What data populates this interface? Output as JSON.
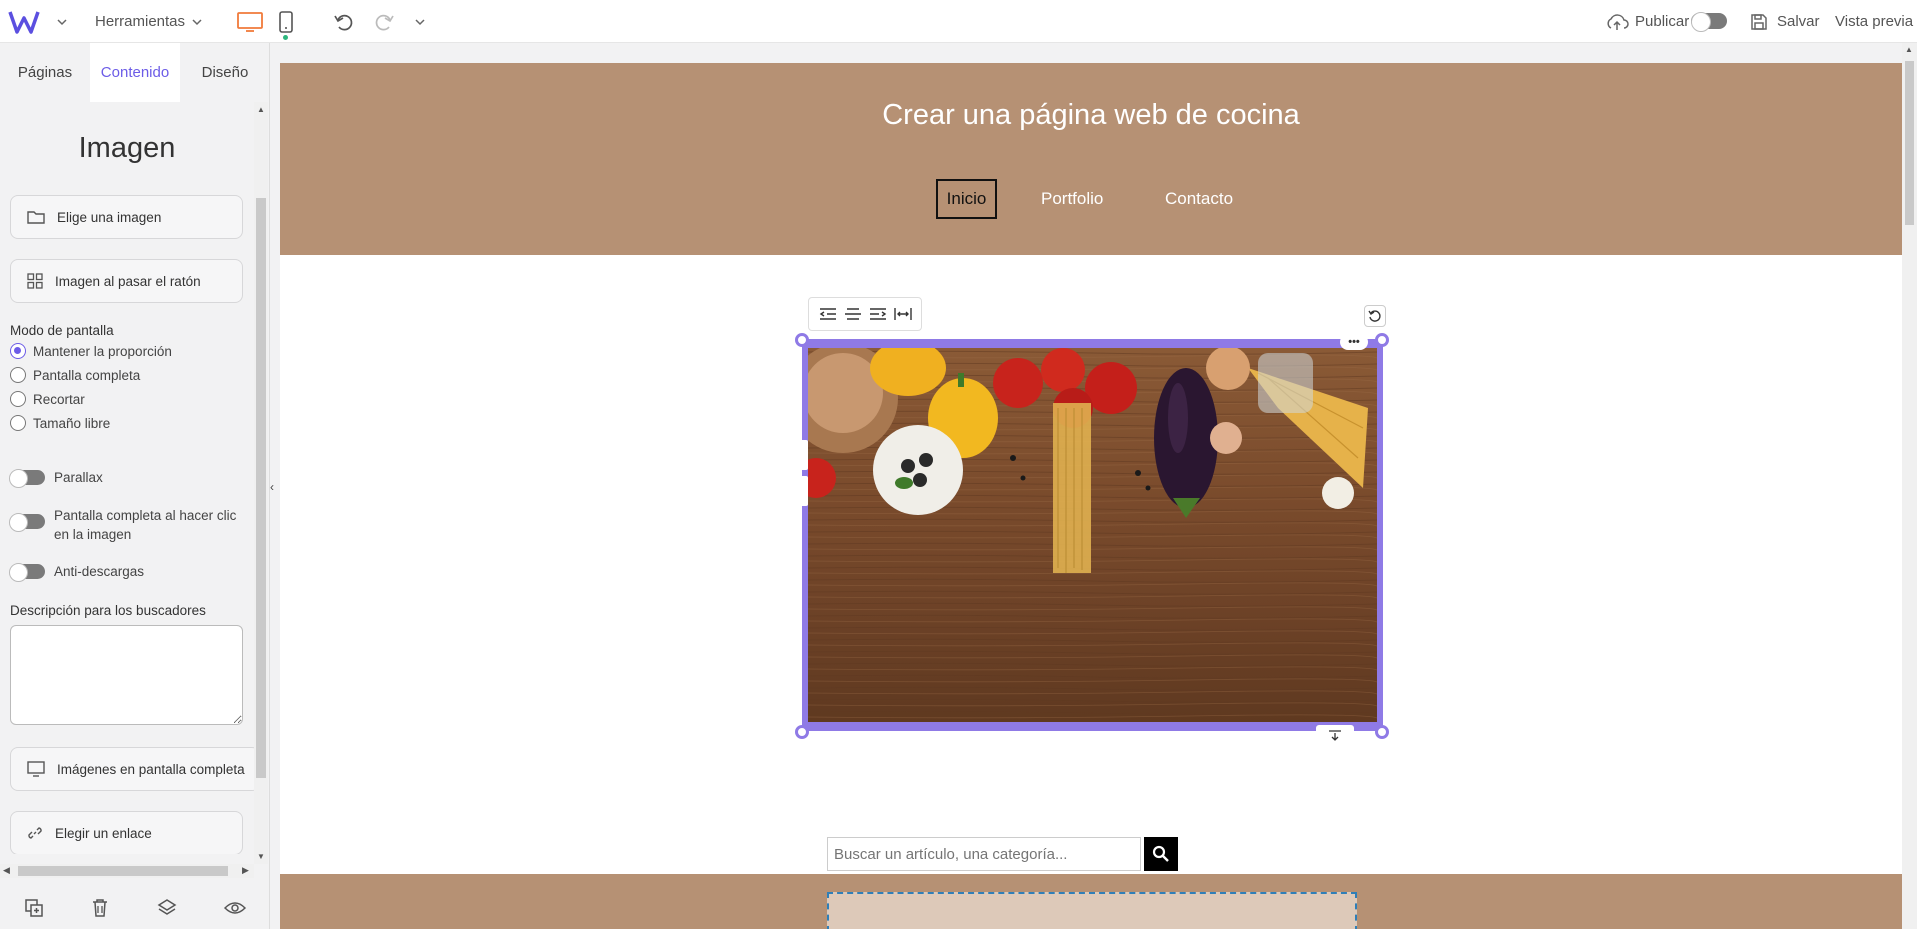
{
  "topbar": {
    "tools_label": "Herramientas",
    "publish_label": "Publicar",
    "save_label": "Salvar",
    "preview_label": "Vista previa"
  },
  "sidebar": {
    "tabs": [
      "Páginas",
      "Contenido",
      "Diseño"
    ],
    "panel_title": "Imagen",
    "choose_image": "Elige una imagen",
    "hover_image": "Imagen al pasar el ratón",
    "display_mode_label": "Modo de pantalla",
    "display_modes": [
      "Mantener la proporción",
      "Pantalla completa",
      "Recortar",
      "Tamaño libre"
    ],
    "selected_mode": "Mantener la proporción",
    "toggles": {
      "parallax": "Parallax",
      "fullscreen_click": "Pantalla completa al hacer clic en la imagen",
      "anti_download": "Anti-descargas"
    },
    "search_desc_label": "Descripción para los buscadores",
    "search_desc_value": "",
    "fullscreen_images": "Imágenes en pantalla completa",
    "choose_link": "Elegir un enlace"
  },
  "site": {
    "title": "Crear una página web de cocina",
    "nav": [
      "Inicio",
      "Portfolio",
      "Contacto"
    ],
    "active_nav": "Inicio",
    "search_placeholder": "Buscar un artículo, una categoría..."
  },
  "colors": {
    "accent": "#6c5ce7",
    "header_band": "#b69174",
    "selection": "#8f7ae6"
  }
}
